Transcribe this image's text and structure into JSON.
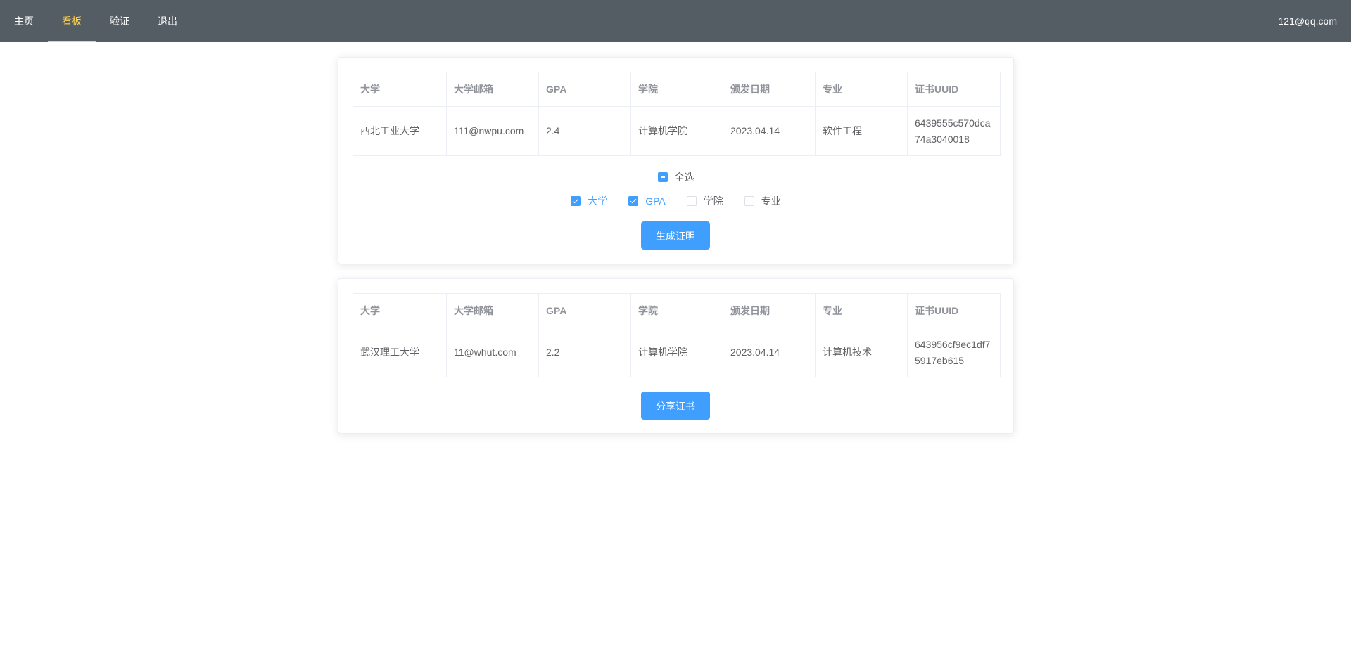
{
  "nav": {
    "items": [
      {
        "label": "主页"
      },
      {
        "label": "看板"
      },
      {
        "label": "验证"
      },
      {
        "label": "退出"
      }
    ],
    "active": "看板",
    "user_email": "121@qq.com"
  },
  "colors": {
    "nav_bg": "#545c64",
    "nav_active": "#ffd04b",
    "primary": "#409eff"
  },
  "table_headers": [
    "大学",
    "大学邮箱",
    "GPA",
    "学院",
    "颁发日期",
    "专业",
    "证书UUID"
  ],
  "cards": [
    {
      "row": [
        "西北工业大学",
        "111@nwpu.com",
        "2.4",
        "计算机学院",
        "2023.04.14",
        "软件工程",
        "6439555c570dca74a3040018"
      ],
      "check_all_label": "全选",
      "check_all_state": "indeterminate",
      "checkboxes": [
        {
          "label": "大学",
          "checked": true
        },
        {
          "label": "GPA",
          "checked": true
        },
        {
          "label": "学院",
          "checked": false
        },
        {
          "label": "专业",
          "checked": false
        }
      ],
      "button_label": "生成证明"
    },
    {
      "row": [
        "武汉理工大学",
        "11@whut.com",
        "2.2",
        "计算机学院",
        "2023.04.14",
        "计算机技术",
        "643956cf9ec1df75917eb615"
      ],
      "button_label": "分享证书"
    }
  ]
}
